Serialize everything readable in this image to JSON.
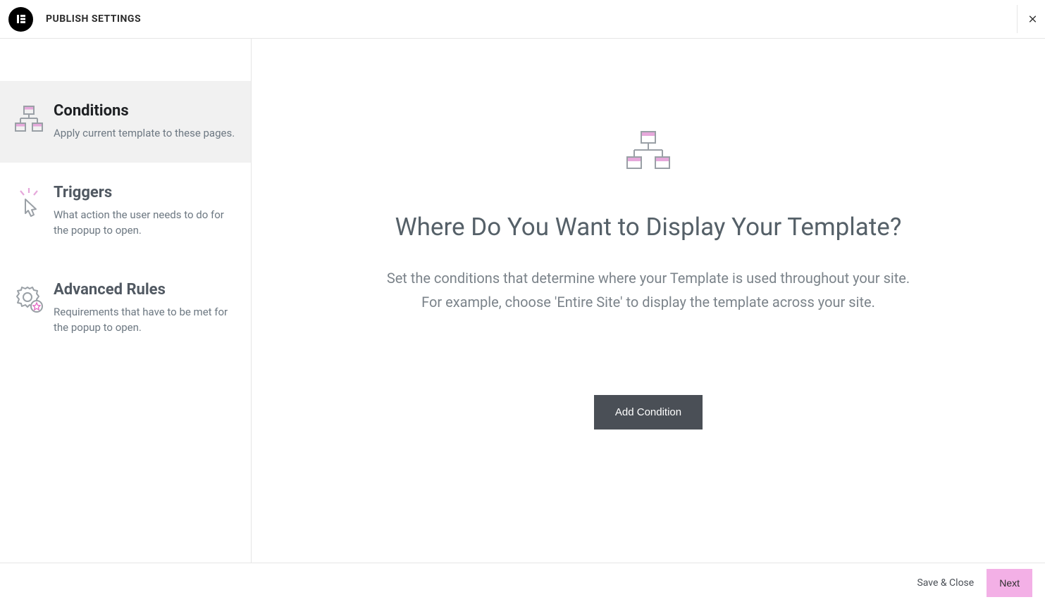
{
  "header": {
    "title": "PUBLISH SETTINGS"
  },
  "sidebar": {
    "tabs": [
      {
        "title": "Conditions",
        "desc": "Apply current template to these pages.",
        "active": true,
        "icon": "hierarchy-icon"
      },
      {
        "title": "Triggers",
        "desc": "What action the user needs to do for the popup to open.",
        "active": false,
        "icon": "click-icon"
      },
      {
        "title": "Advanced Rules",
        "desc": "Requirements that have to be met for the popup to open.",
        "active": false,
        "icon": "gear-star-icon"
      }
    ]
  },
  "content": {
    "heading": "Where Do You Want to Display Your Template?",
    "desc_line1": "Set the conditions that determine where your Template is used throughout your site.",
    "desc_line2": "For example, choose 'Entire Site' to display the template across your site.",
    "add_button": "Add Condition"
  },
  "footer": {
    "save_close": "Save & Close",
    "next": "Next"
  }
}
